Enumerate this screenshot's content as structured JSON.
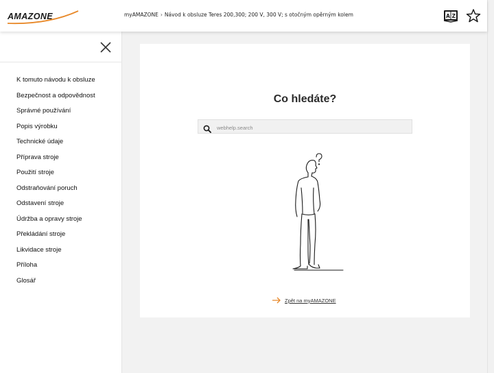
{
  "header": {
    "logo_text": "AMAZONE",
    "breadcrumb": {
      "root": "myAMAZONE",
      "separator": "›",
      "current": "Návod k obsluze Teres 200,300; 200 V, 300 V; s otočným opěrným kolem"
    },
    "icons": [
      "language-dictionary-icon",
      "favorite-star-icon"
    ]
  },
  "sidebar": {
    "close_icon": "close-icon",
    "items": [
      {
        "label": "K tomuto návodu k obsluze"
      },
      {
        "label": "Bezpečnost a odpovědnost"
      },
      {
        "label": "Správné používání"
      },
      {
        "label": "Popis výrobku"
      },
      {
        "label": "Technické údaje"
      },
      {
        "label": "Příprava stroje"
      },
      {
        "label": "Použití stroje"
      },
      {
        "label": "Odstraňování poruch"
      },
      {
        "label": "Odstavení stroje"
      },
      {
        "label": "Údržba a opravy stroje"
      },
      {
        "label": "Překládání stroje"
      },
      {
        "label": "Likvidace stroje"
      },
      {
        "label": "Příloha"
      },
      {
        "label": "Glosář"
      }
    ]
  },
  "main": {
    "heading": "Co hledáte?",
    "search": {
      "placeholder": "webhelp.search",
      "value": ""
    },
    "illustration": "person-wondering-question-mark",
    "back_link": {
      "label": "Zpět na myAMAZONE"
    }
  },
  "colors": {
    "accent_orange": "#e8892a",
    "page_background": "#f2f2f2",
    "text": "#222222"
  }
}
